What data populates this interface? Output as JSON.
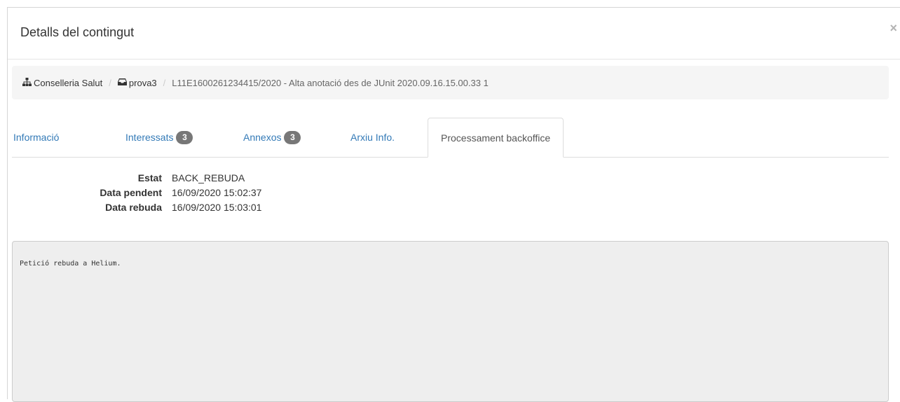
{
  "modal": {
    "title": "Detalls del contingut",
    "close_label": "×"
  },
  "breadcrumb": {
    "items": [
      {
        "label": "Conselleria Salut",
        "icon": "sitemap-icon"
      },
      {
        "label": "prova3",
        "icon": "inbox-icon"
      },
      {
        "label": "L11E1600261234415/2020 - Alta anotació des de JUnit 2020.09.16.15.00.33 1"
      }
    ],
    "separator": "/"
  },
  "tabs": [
    {
      "label": "Informació",
      "badge": null,
      "active": false
    },
    {
      "label": "Interessats",
      "badge": "3",
      "active": false
    },
    {
      "label": "Annexos",
      "badge": "3",
      "active": false
    },
    {
      "label": "Arxiu Info.",
      "badge": null,
      "active": false
    },
    {
      "label": "Processament backoffice",
      "badge": null,
      "active": true
    }
  ],
  "details": [
    {
      "label": "Estat",
      "value": "BACK_REBUDA"
    },
    {
      "label": "Data pendent",
      "value": "16/09/2020 15:02:37"
    },
    {
      "label": "Data rebuda",
      "value": "16/09/2020 15:03:01"
    }
  ],
  "log": {
    "text": "Petició rebuda a Helium."
  },
  "colors": {
    "link": "#337ab7",
    "badge": "#777777",
    "breadcrumb_bg": "#f5f5f5",
    "log_bg": "#eeeeee"
  }
}
